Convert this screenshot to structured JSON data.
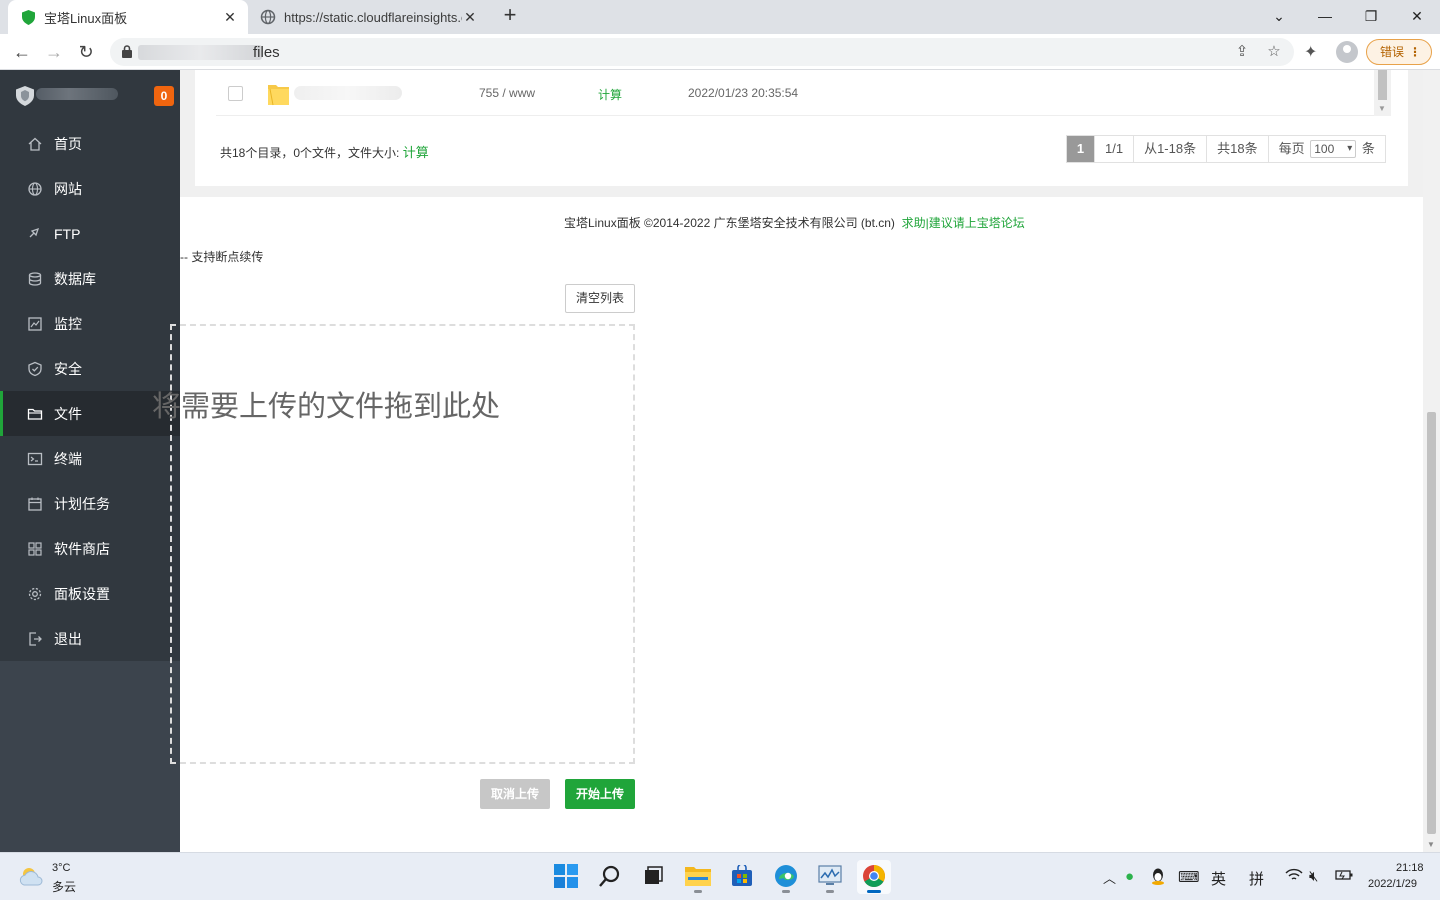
{
  "browser": {
    "tabs": [
      {
        "title": "宝塔Linux面板",
        "favicon": "bt-shield-icon",
        "active": true
      },
      {
        "title": "https://static.cloudflareinsights.com",
        "favicon": "globe-icon",
        "active": false
      }
    ],
    "new_tab": "+",
    "address_suffix": "files",
    "error_button": "错误"
  },
  "sidebar": {
    "notification_count": "0",
    "items": [
      {
        "label": "首页",
        "icon": "home-icon"
      },
      {
        "label": "网站",
        "icon": "globe-icon"
      },
      {
        "label": "FTP",
        "icon": "ftp-icon"
      },
      {
        "label": "数据库",
        "icon": "database-icon"
      },
      {
        "label": "监控",
        "icon": "monitor-icon"
      },
      {
        "label": "安全",
        "icon": "shield-icon"
      },
      {
        "label": "文件",
        "icon": "folder-icon",
        "active": true
      },
      {
        "label": "终端",
        "icon": "terminal-icon"
      },
      {
        "label": "计划任务",
        "icon": "calendar-icon"
      },
      {
        "label": "软件商店",
        "icon": "apps-icon"
      },
      {
        "label": "面板设置",
        "icon": "gear-icon"
      },
      {
        "label": "退出",
        "icon": "logout-icon"
      }
    ]
  },
  "file_list": {
    "row": {
      "permission": "755 / www",
      "size_action": "计算",
      "modified": "2022/01/23 20:35:54"
    },
    "summary_text": "共18个目录，0个文件，文件大小: ",
    "summary_link": "计算"
  },
  "pagination": {
    "current": "1",
    "pages": "1/1",
    "range": "从1-18条",
    "total": "共18条",
    "per_page_label": "每页",
    "per_page_value": "100",
    "per_page_unit": "条"
  },
  "footer": {
    "copyright": "宝塔Linux面板 ©2014-2022 广东堡塔安全技术有限公司 (bt.cn)",
    "forum_link": "求助|建议请上宝塔论坛"
  },
  "upload": {
    "note": "-- 支持断点续传",
    "clear_list": "清空列表",
    "drop_hint": "将需要上传的文件拖到此处",
    "cancel": "取消上传",
    "start": "开始上传"
  },
  "taskbar": {
    "weather_temp": "3°C",
    "weather_desc": "多云",
    "ime_lang": "英",
    "ime_mode": "拼",
    "time": "21:18",
    "date": "2022/1/29"
  },
  "colors": {
    "brand_green": "#20a53a",
    "sidebar_bg": "#3c444d",
    "sidebar_menu_bg": "#31383f",
    "badge_orange": "#f0650f"
  }
}
